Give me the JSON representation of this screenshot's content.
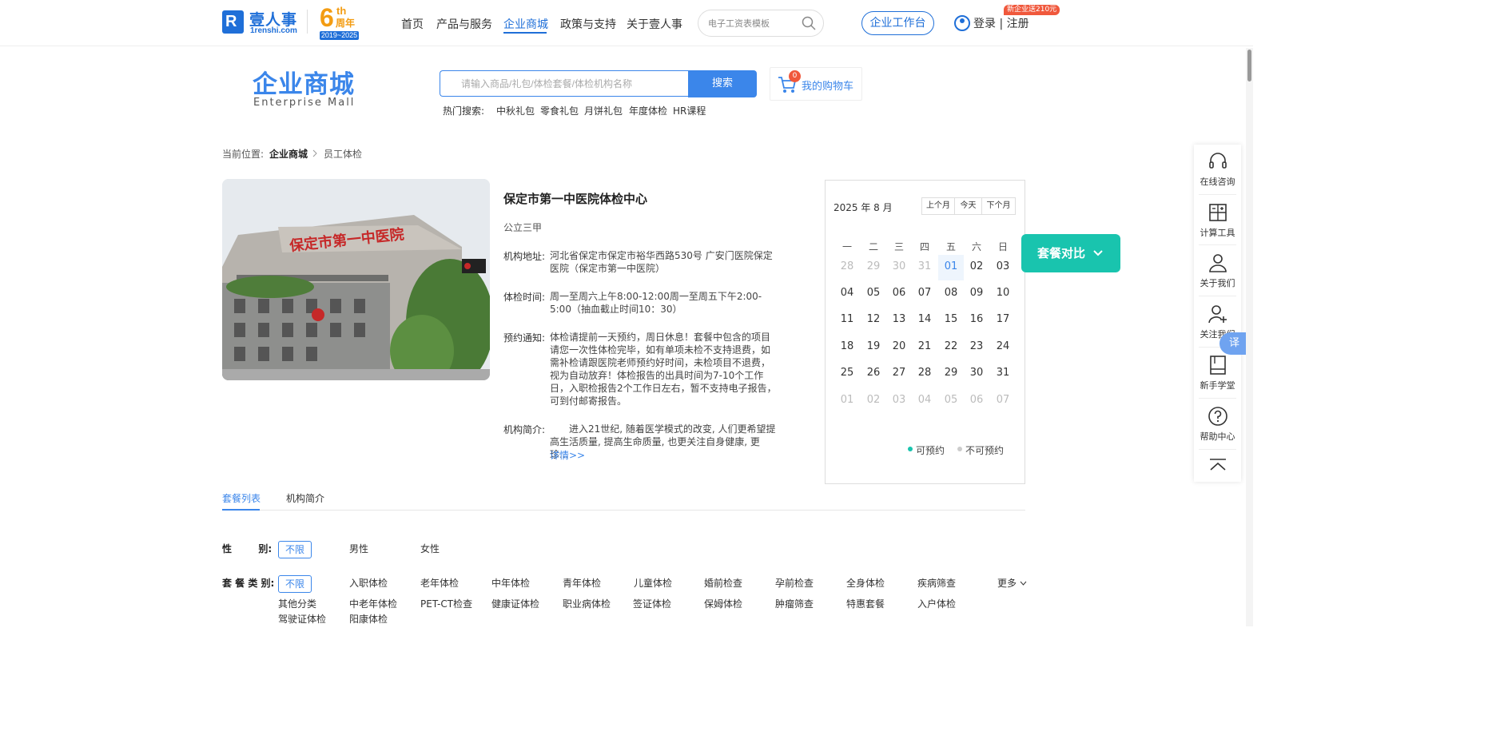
{
  "header": {
    "logo_text": "壹人事",
    "logo_sub": "1renshi.com",
    "anniversary": {
      "num": "6",
      "suffix": "th",
      "label": "周年",
      "years": "2019~2025"
    },
    "nav": [
      "首页",
      "产品与服务",
      "企业商城",
      "政策与支持",
      "关于壹人事"
    ],
    "search_placeholder": "电子工资表模板",
    "workbench": "企业工作台",
    "promo": "新企业送210元",
    "login": "登录 | 注册"
  },
  "mall": {
    "title": "企业商城",
    "subtitle": "Enterprise  Mall",
    "search_placeholder": "请输入商品/礼包/体检套餐/体检机构名称",
    "search_button": "搜索",
    "cart_count": "0",
    "cart_label": "我的购物车",
    "hot_label": "热门搜索:",
    "hot_items": [
      "中秋礼包",
      "零食礼包",
      "月饼礼包",
      "年度体检",
      "HR课程"
    ]
  },
  "breadcrumb": {
    "prefix": "当前位置:",
    "items": [
      "企业商城",
      "员工体检"
    ]
  },
  "hospital": {
    "name": "保定市第一中医院体检中心",
    "grade": "公立三甲",
    "address_label": "机构地址:",
    "address": "河北省保定市保定市裕华西路530号 广安门医院保定医院（保定市第一中医院）",
    "hours_label": "体检时间:",
    "hours": "周一至周六上午8:00-12:00周一至周五下午2:00-5:00（抽血截止时间10：30）",
    "notice_label": "预约通知:",
    "notice": "体检请提前一天预约，周日休息！套餐中包含的项目请您一次性体检完毕，如有单项未检不支持退费，如需补检请跟医院老师预约好时间，未检项目不退费，视为自动放弃！体检报告的出具时间为7-10个工作日，入职检报告2个工作日左右，暂不支持电子报告，可到付邮寄报告。",
    "intro_label": "机构简介:",
    "intro": "进入21世纪, 随着医学模式的改变, 人们更希望提高生活质量, 提高生命质量, 也更关注自身健康, 更珍...",
    "more": "详情>>",
    "photo_sign": "保定市第一中医院"
  },
  "calendar": {
    "title": "2025 年 8 月",
    "buttons": [
      "上个月",
      "今天",
      "下个月"
    ],
    "weekdays": [
      "一",
      "二",
      "三",
      "四",
      "五",
      "六",
      "日"
    ],
    "weeks": [
      [
        "28",
        "29",
        "30",
        "31",
        "01",
        "02",
        "03"
      ],
      [
        "04",
        "05",
        "06",
        "07",
        "08",
        "09",
        "10"
      ],
      [
        "11",
        "12",
        "13",
        "14",
        "15",
        "16",
        "17"
      ],
      [
        "18",
        "19",
        "20",
        "21",
        "22",
        "23",
        "24"
      ],
      [
        "25",
        "26",
        "27",
        "28",
        "29",
        "30",
        "31"
      ],
      [
        "01",
        "02",
        "03",
        "04",
        "05",
        "06",
        "07"
      ]
    ],
    "legend_available": "可预约",
    "legend_unavailable": "不可预约",
    "available_color": "#19c4ae",
    "unavailable_color": "#cccccc"
  },
  "compare": "套餐对比",
  "sidebar": [
    {
      "label": "在线咨询",
      "icon": "headset-icon"
    },
    {
      "label": "计算工具",
      "icon": "calculator-icon"
    },
    {
      "label": "关于我们",
      "icon": "user-icon"
    },
    {
      "label": "关注我们",
      "icon": "user-add-icon"
    },
    {
      "label": "新手学堂",
      "icon": "book-icon"
    },
    {
      "label": "帮助中心",
      "icon": "help-icon"
    }
  ],
  "translate": "译",
  "tabs": [
    "套餐列表",
    "机构简介"
  ],
  "filters": {
    "gender_label": "性        别:",
    "gender_selected": "不限",
    "gender_options": [
      "男性",
      "女性"
    ],
    "type_label": "套 餐 类 别:",
    "type_selected": "不限",
    "type_options": [
      "入职体检",
      "老年体检",
      "中年体检",
      "青年体检",
      "儿童体检",
      "婚前检查",
      "孕前检查",
      "全身体检",
      "疾病筛查"
    ],
    "type_more": "更多",
    "type_options2": [
      "其他分类",
      "中老年体检",
      "PET-CT检查",
      "健康证体检",
      "职业病体检",
      "签证体检",
      "保姆体检",
      "肿瘤筛查",
      "特惠套餐",
      "入户体检"
    ],
    "type_options3": [
      "驾驶证体检",
      "阳康体检"
    ]
  },
  "colors": {
    "primary": "#1f6fd8",
    "accent": "#3b86ea",
    "teal": "#19c4ae",
    "orange": "#f39c12",
    "red": "#f0583c"
  }
}
